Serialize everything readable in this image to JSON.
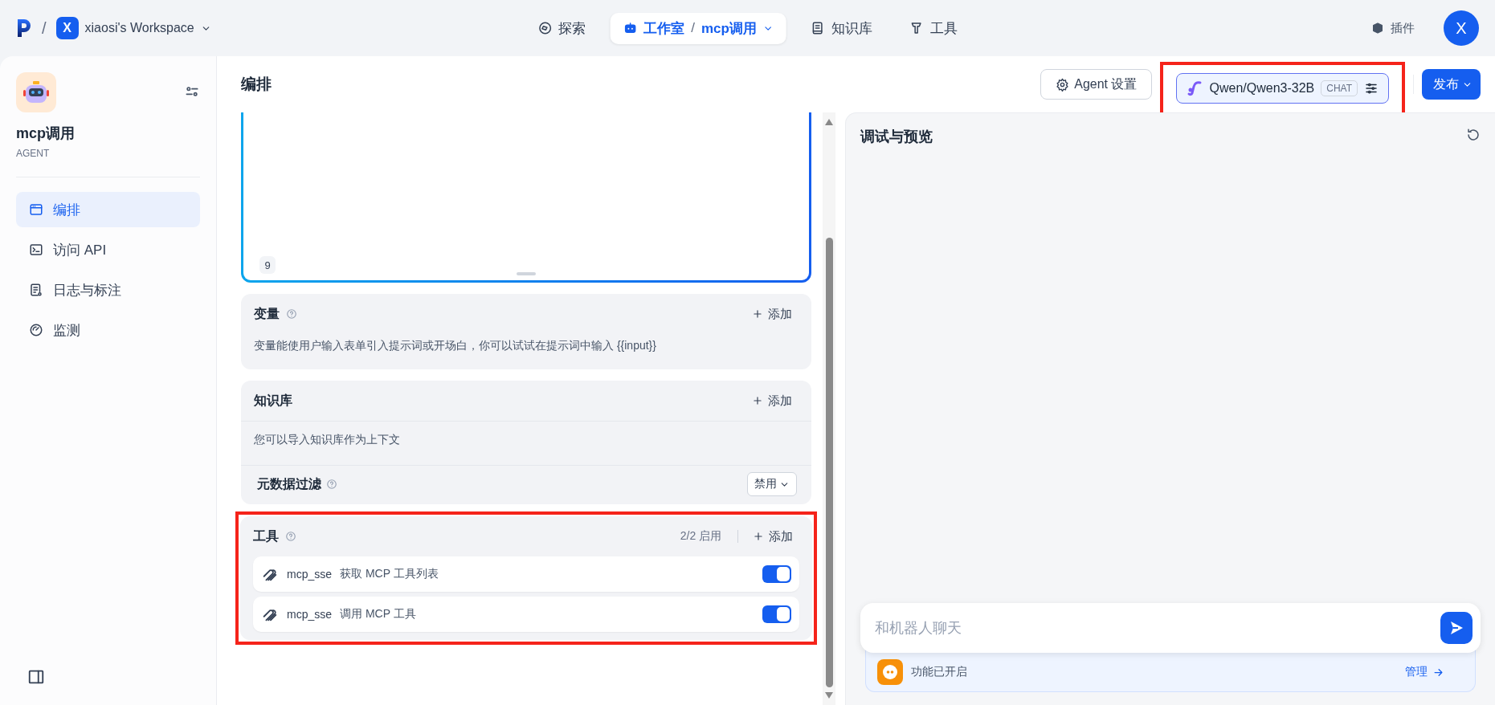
{
  "topbar": {
    "separator": "/",
    "workspace_initial": "X",
    "workspace_name": "xiaosi's Workspace",
    "nav": [
      {
        "label": "探索",
        "selected": false
      },
      {
        "label": "工作室",
        "selected": true,
        "separator": "/",
        "sub": "mcp调用"
      },
      {
        "label": "知识库",
        "selected": false
      },
      {
        "label": "工具",
        "selected": false
      }
    ],
    "plugins": "插件",
    "avatar": "X"
  },
  "sidebar": {
    "app_name": "mcp调用",
    "app_type": "AGENT",
    "items": [
      {
        "label": "编排",
        "selected": true
      },
      {
        "label": "访问 API",
        "selected": false
      },
      {
        "label": "日志与标注",
        "selected": false
      },
      {
        "label": "监测",
        "selected": false
      }
    ]
  },
  "header": {
    "title": "编排",
    "agent_settings": "Agent 设置",
    "model": {
      "name": "Qwen/Qwen3-32B",
      "mode": "CHAT",
      "highlighted": true
    },
    "publish": "发布"
  },
  "prompt": {
    "line_number": "9"
  },
  "sections": [
    {
      "kind": "variables",
      "title": "变量",
      "help": true,
      "add": "添加",
      "description": "变量能使用户输入表单引入提示词或开场白，你可以试试在提示词中输入 {{input}}",
      "highlighted": false
    },
    {
      "kind": "knowledge",
      "title": "知识库",
      "help": false,
      "add": "添加",
      "description": "您可以导入知识库作为上下文",
      "filter": {
        "label": "元数据过滤",
        "value": "禁用"
      },
      "highlighted": false
    },
    {
      "kind": "tools",
      "title": "工具",
      "help": true,
      "count": "2/2 启用",
      "add": "添加",
      "highlighted": true,
      "tools": [
        {
          "provider": "mcp_sse",
          "name": "获取 MCP 工具列表",
          "on": true
        },
        {
          "provider": "mcp_sse",
          "name": "调用 MCP 工具",
          "on": true
        }
      ]
    }
  ],
  "preview": {
    "title": "调试与预览",
    "chat_placeholder": "和机器人聊天",
    "feature_status": "功能已开启",
    "manage": "管理"
  }
}
